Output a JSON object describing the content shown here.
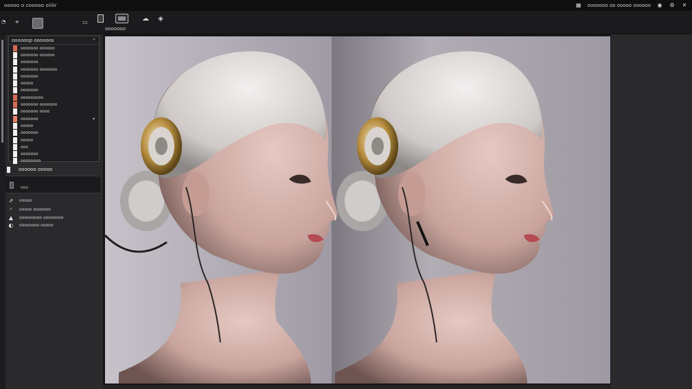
{
  "titlebar": {
    "app_title": "ooooo o cooooo oiiiir",
    "status_text": "ooooooo oo ooooo oooooo"
  },
  "toolbar": {
    "selection_label": "ooooooo"
  },
  "layers": {
    "header_label": "oooooop oooooos",
    "items": [
      {
        "label": "ooooooo oooooo",
        "color": "#d66a55"
      },
      {
        "label": "ooooooo oooooo",
        "color": "#f2f2f2"
      },
      {
        "label": "ooooooo",
        "color": "#f2f2f2"
      },
      {
        "label": "ooooooo ooooooo",
        "color": "#f2f2f2"
      },
      {
        "label": "ooooooo",
        "color": "#f2f2f2"
      },
      {
        "label": "ooooo",
        "color": "#f2f2f2"
      },
      {
        "label": "ooooooo",
        "color": "#f2f2f2"
      },
      {
        "label": "ooooooooo",
        "color": "#d66a55"
      },
      {
        "label": "ooooooo ooooooo",
        "color": "#d66a55"
      },
      {
        "label": "ooooooo oooo",
        "color": "#f2f2f2"
      },
      {
        "label": "ooooooo",
        "color": "#e8836a"
      },
      {
        "label": "ooooo",
        "color": "#f2f2f2"
      },
      {
        "label": "ooooooo",
        "color": "#f2f2f2"
      },
      {
        "label": "ooooo",
        "color": "#f2f2f2"
      },
      {
        "label": "ooo",
        "color": "#f2f2f2"
      },
      {
        "label": "ooooooo",
        "color": "#f2f2f2"
      },
      {
        "label": "oooooooo",
        "color": "#f2f2f2"
      }
    ]
  },
  "properties": {
    "header_label": "oooooo ooooo",
    "field_value": "ooo"
  },
  "tools": [
    {
      "icon": "brush-icon",
      "glyph": "⇗",
      "label": "ooooo"
    },
    {
      "icon": "dodge-icon",
      "glyph": "◜",
      "label": "ooooo ooooooo"
    },
    {
      "icon": "sharpen-icon",
      "glyph": "▲",
      "label": "ooooooooo oooooooo"
    },
    {
      "icon": "blend-icon",
      "glyph": "◐",
      "label": "oooooooo ooooo"
    }
  ],
  "colors": {
    "accent_red": "#d66a55",
    "panel_bg": "#2a2a2c",
    "titlebar_bg": "#0f0f10",
    "backdrop": "#a9a6ad"
  }
}
